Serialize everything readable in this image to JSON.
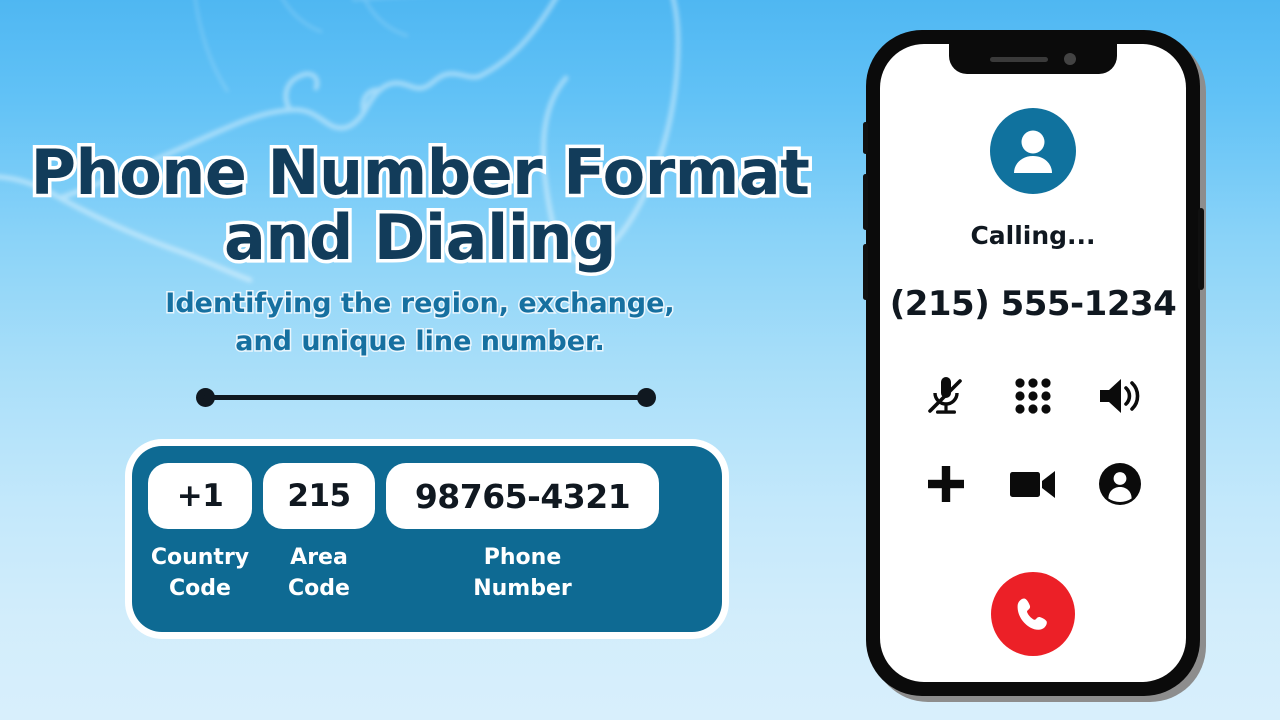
{
  "background": {
    "gradient_top": "#4FB7F2",
    "gradient_bottom": "#D8EFFC",
    "watermark_icon": "map-outline-watermark"
  },
  "left_panel": {
    "title_line1": "Phone Number Format",
    "title_line2": "and Dialing",
    "title_color": "#123C5A",
    "subtitle_line1": "Identifying the region, exchange,",
    "subtitle_line2": "and unique line number.",
    "subtitle_color": "#1670A0",
    "divider_icon": "line-with-end-dots"
  },
  "format_bar": {
    "accent_color": "#0E6A93",
    "segments": [
      {
        "value": "+1",
        "label_line1": "Country",
        "label_line2": "Code"
      },
      {
        "value": "215",
        "label_line1": "Area",
        "label_line2": "Code"
      },
      {
        "value": "98765-4321",
        "label_line1": "Phone",
        "label_line2": "Number"
      }
    ]
  },
  "phone": {
    "frame_color": "#0B0B0B",
    "avatar_icon": "user-avatar-icon",
    "avatar_color": "#10729E",
    "status_text": "Calling...",
    "number_text": "(215) 555-1234",
    "actions": [
      {
        "icon": "microphone-muted-icon",
        "name": "mute-button"
      },
      {
        "icon": "keypad-icon",
        "name": "keypad-button"
      },
      {
        "icon": "speaker-icon",
        "name": "speaker-button"
      },
      {
        "icon": "plus-icon",
        "name": "add-call-button"
      },
      {
        "icon": "video-camera-icon",
        "name": "video-call-button"
      },
      {
        "icon": "contact-circle-icon",
        "name": "contacts-button"
      }
    ],
    "end_call": {
      "icon": "phone-handset-icon",
      "color": "#EC2027"
    },
    "side_buttons": [
      "mute-switch",
      "volume-up",
      "volume-down",
      "power"
    ]
  }
}
